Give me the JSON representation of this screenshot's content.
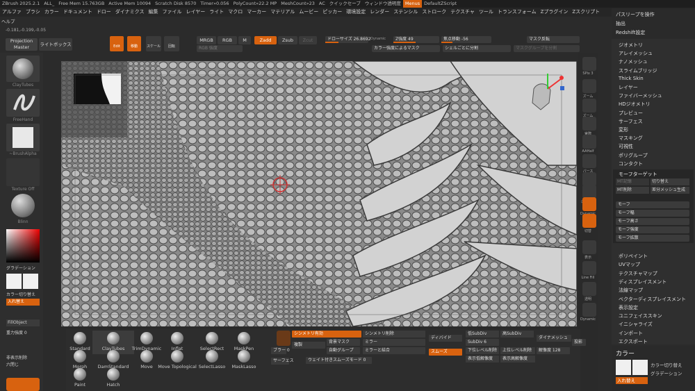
{
  "title_bar": [
    "ZBrush 2025.2.1",
    "ALL_",
    "Free Mem 15.763GB",
    "Active Mem 10094",
    "Scratch Disk 8570",
    "Timer»0.056",
    "PolyCount»22.2 MP",
    "MeshCount»23",
    "AC",
    "クイックセーブ",
    "ウィンドウ透明度",
    "Menus",
    "DefaultZScript"
  ],
  "menu_bar": [
    "アルファ",
    "ブラシ",
    "カラー",
    "ドキュメント",
    "ドロー",
    "ダイナミクス",
    "編集",
    "ファイル",
    "レイヤー",
    "ライト",
    "マクロ",
    "マーカー",
    "マテリアル",
    "ムービー",
    "ピッカー",
    "環境設定",
    "レンダー",
    "ステンシル",
    "ストローク",
    "テクスチャ",
    "ツール",
    "トランスフォーム",
    "Zプラグイン",
    "Zスクリプト"
  ],
  "help": "ヘルプ",
  "coords": "-0.181,-0.199,-0.05",
  "projection_master": "Projection Master",
  "lightbox": "ライトボックス",
  "toolbar": {
    "edit": "Edit",
    "move": "移動",
    "scale": "スケール",
    "rotate": "回転",
    "mrgb": "MRGB",
    "rgb": "RGB",
    "m": "M",
    "zadd": "Zadd",
    "zsub": "Zsub",
    "zcut": "Zcut",
    "rgb_intensity": "RGB 強度",
    "draw_size": "ドローサイズ 26.8692",
    "dynamic": "Dynamic",
    "z_intensity": "Z強度 49",
    "focal_shift": "焦点移動 -56",
    "mask_invert": "マスク反転",
    "color_mask": "カラー強度によるマスク",
    "split_shell": "シェルごとに分割",
    "mask_by_group": "マスクグループを分割"
  },
  "left": {
    "claytubes": "ClayTubes",
    "freehand": "FreeHand",
    "brushalpha": "~BrushAlpha",
    "texture_off": "Texture Off",
    "material": "Blinn",
    "gradient": "グラデーション",
    "color_switch": "カラー切り替え",
    "swap": "入れ替え",
    "fillobject": "FillObject",
    "gravity": "重力強度 0",
    "show_hide": "非表示削除",
    "hide": "六閉じ"
  },
  "right_shelf": [
    "SPix 3",
    "ズーム",
    "ズーム",
    "実際",
    "AAHalf",
    "パース",
    "射影",
    "ローカル",
    "Dynamic",
    "切替",
    "表示",
    "Line Fill",
    "透明",
    "Dynamic"
  ],
  "top_menu": [
    "パスリープを操作",
    "抽出",
    "Redshift設定"
  ],
  "right_menu": [
    "ジオメトリ",
    "アレイメッシュ",
    "ナノメッシュ",
    "スライムブリッジ",
    "Thick Skin",
    "レイヤー",
    "ファイバーメッシュ",
    "HDジオメトリ",
    "プレビュー",
    "サーフェス",
    "変形",
    "マスキング",
    "可視性",
    "ポリグループ",
    "コンタクト"
  ],
  "morph": {
    "header": "モーフターゲット",
    "store": "MT記憶",
    "switch": "切り替え",
    "delete": "MT削除",
    "diff": "差分メッシュ生成",
    "rows": [
      "モーフ",
      "モーフ幅",
      "モーフ高さ",
      "モーフ強度",
      "モーフ拡散"
    ]
  },
  "right_menu2": [
    "ポリペイント",
    "UVマップ",
    "テクスチャマップ",
    "ディスプレイスメント",
    "法線マップ",
    "ベクターディスプレイスメント",
    "表示設定",
    "ユニフェイススキン",
    "イニシャライズ",
    "インポート",
    "エクスポート"
  ],
  "color_panel": {
    "title": "カラー",
    "switch": "カラー切り替え",
    "gradient": "グラデーション",
    "swap": "入れ替え"
  },
  "brushes": [
    [
      "Standard",
      "ClayTubes",
      "TrimDynamic",
      "Inflat",
      "SelectRect",
      "MaskPen"
    ],
    [
      "Morph",
      "DamStandard",
      "Move",
      "Move Topological",
      "SelectLasso",
      "MaskLasso"
    ],
    [
      "Paint",
      "Hatch"
    ]
  ],
  "bottom": {
    "blur": "ブラー 0",
    "surface": "サーフェス",
    "sym_on": "シンメトリ有効",
    "sym_del": "シンメトリ削除",
    "mirror": "ミラー",
    "mirror_merge": "ミラーと結合",
    "dup": "複製",
    "bg_mask": "背景マスク",
    "auto_group": "自動グループ",
    "weighted_smooth": "ウェイト付きスムーズモード 0",
    "divide": "ディバイド",
    "smooth": "スムーズ",
    "lowsub": "低SubDiv",
    "highsub": "高SubDiv",
    "subdiv": "SubDiv 6",
    "lower_del": "下位レベル削除",
    "upper_del": "上位レベル削除",
    "res": "解像度 128",
    "show_low": "表示低解像度",
    "show_high": "表示高解像度",
    "dynamesh": "ダイナメッシュ",
    "project": "投影"
  },
  "colors": {
    "accent": "#d8620f"
  }
}
